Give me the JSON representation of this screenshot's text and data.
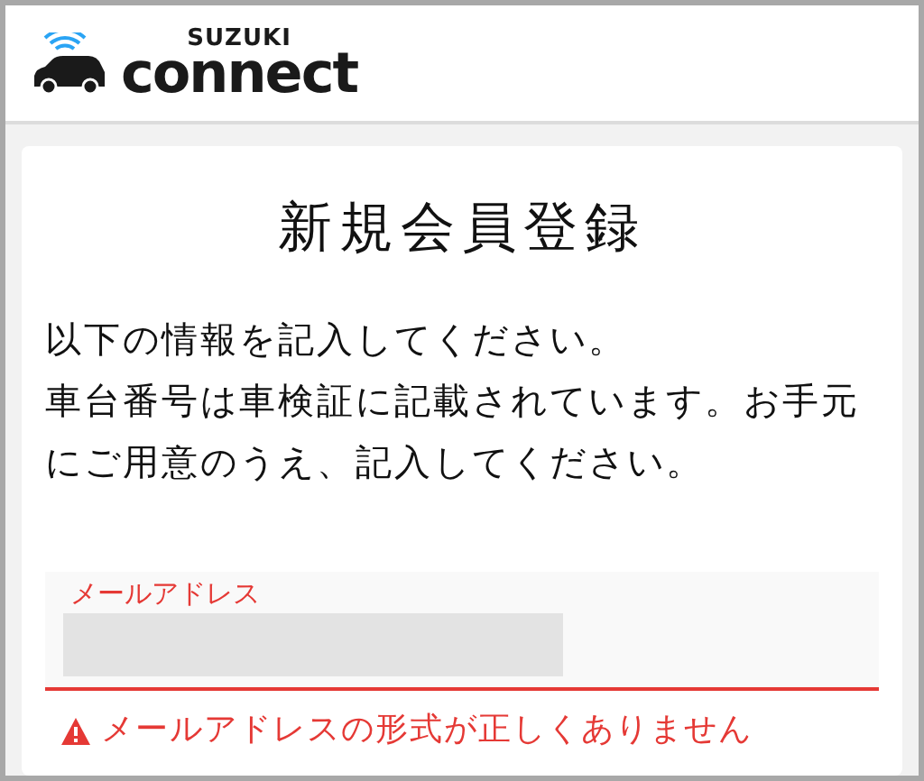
{
  "header": {
    "brand_top": "SUZUKI",
    "brand_main": "connect"
  },
  "card": {
    "title": "新規会員登録",
    "paragraphs": [
      "以下の情報を記入してください。",
      "車台番号は車検証に記載されています。お手元にご用意のうえ、記入してください。"
    ],
    "field": {
      "label": "メールアドレス",
      "value_redacted": true,
      "error": "メールアドレスの形式が正しくありません"
    }
  }
}
